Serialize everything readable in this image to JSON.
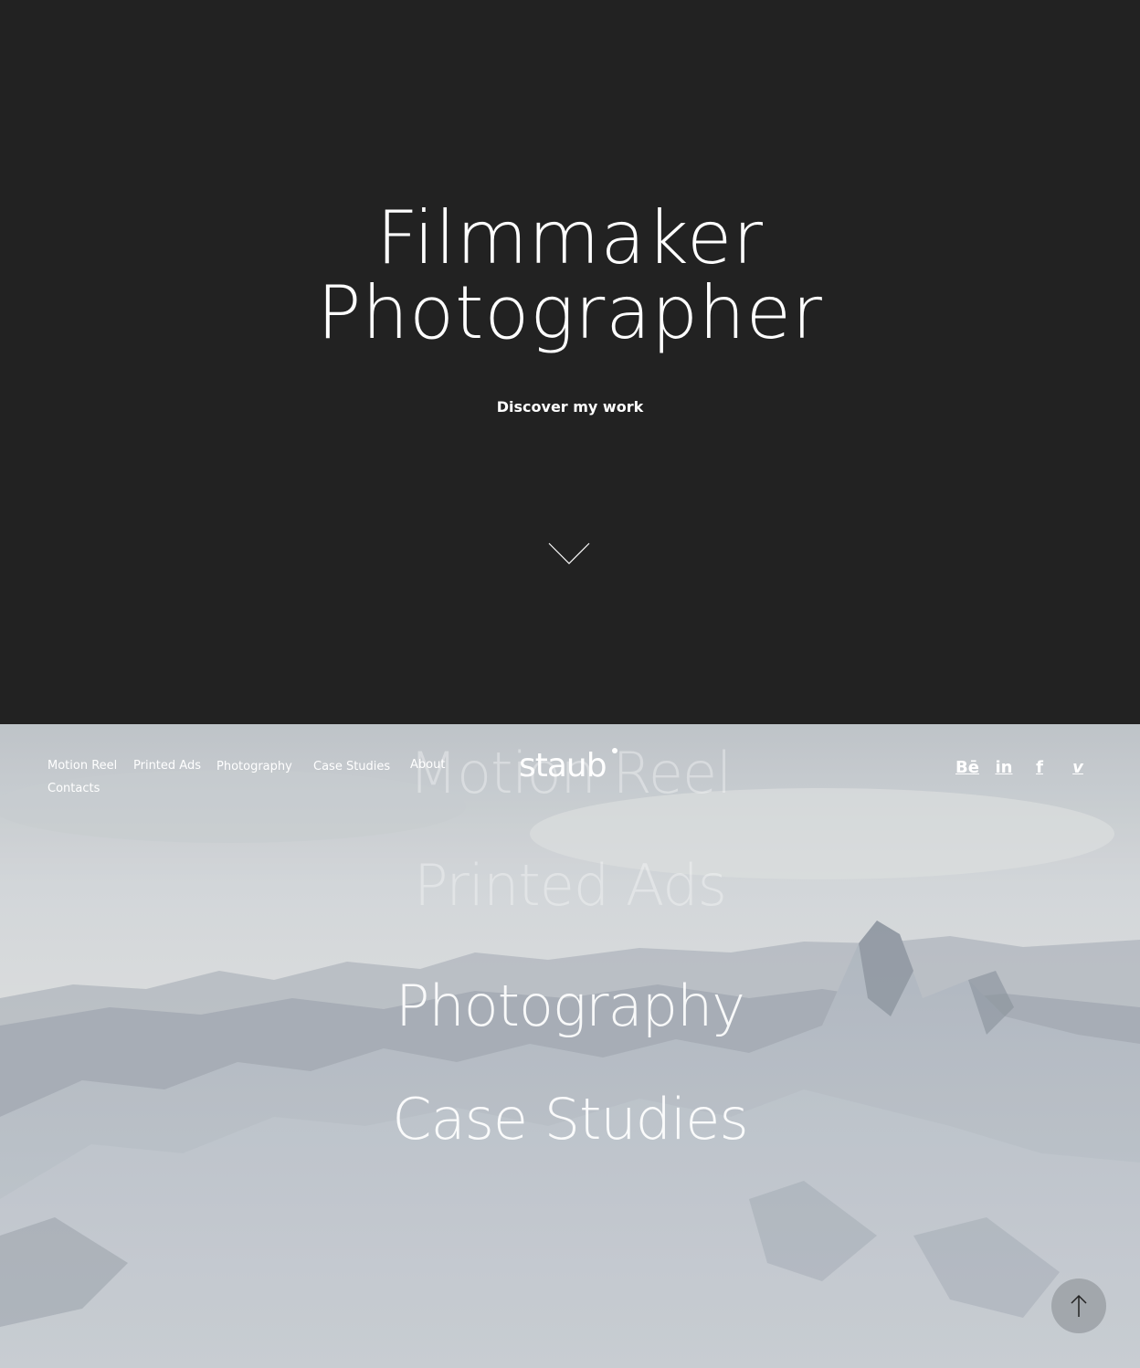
{
  "hero": {
    "title_line1": "Filmmaker",
    "title_line2": "Photographer",
    "cta": "Discover my work",
    "scroll_icon": "chevron-down-icon"
  },
  "header": {
    "logo": "staub",
    "nav": [
      "Motion Reel",
      "Printed Ads",
      "Photography",
      "Case Studies",
      "About",
      "Contacts"
    ],
    "social": [
      {
        "name": "behance",
        "glyph": "Bē"
      },
      {
        "name": "linkedin",
        "glyph": "in"
      },
      {
        "name": "facebook",
        "glyph": "f"
      },
      {
        "name": "vimeo",
        "glyph": "v"
      }
    ]
  },
  "overlay_menu": {
    "items": [
      "Motion Reel",
      "Printed Ads",
      "Photography",
      "Case Studies"
    ]
  },
  "back_to_top_icon": "arrow-up-icon",
  "colors": {
    "hero_bg": "#222222",
    "text": "#ffffff"
  }
}
